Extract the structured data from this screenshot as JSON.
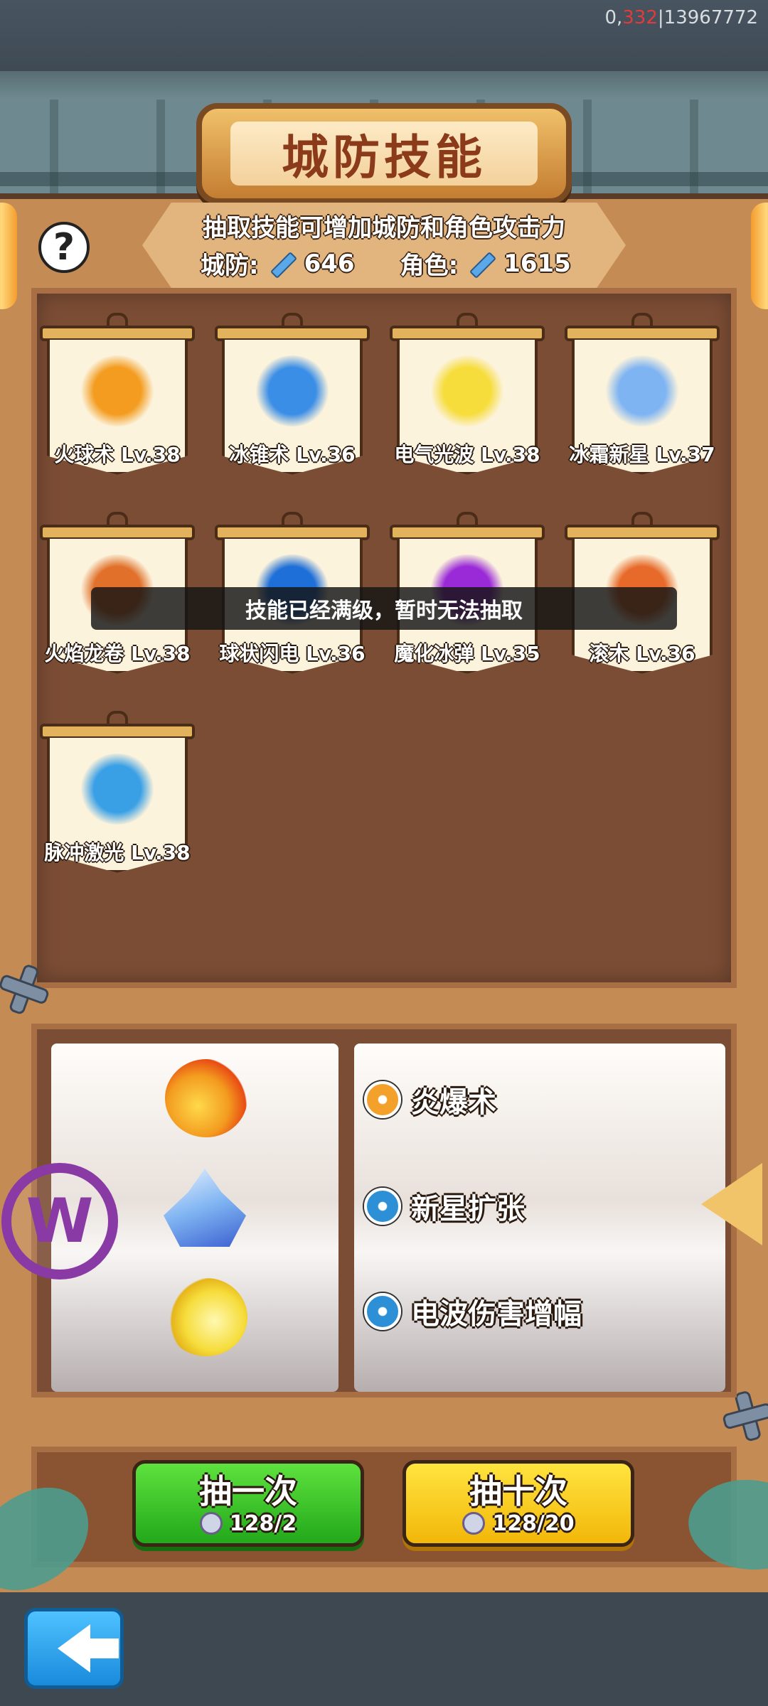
{
  "status_bar": {
    "prefix": "0,",
    "red": "332",
    "suffix": "|13967772"
  },
  "title": "城防技能",
  "info": {
    "description": "抽取技能可增加城防和角色攻击力",
    "defense_label": "城防:",
    "defense_value": "646",
    "role_label": "角色:",
    "role_value": "1615"
  },
  "help_label": "?",
  "skills": [
    {
      "label": "火球术 Lv.38",
      "icon": "fireball-icon",
      "color": "#f39c1f"
    },
    {
      "label": "冰锥术 Lv.36",
      "icon": "ice-cone-icon",
      "color": "#3b8ee6"
    },
    {
      "label": "电气光波 Lv.38",
      "icon": "electric-wave-icon",
      "color": "#f6dd3c"
    },
    {
      "label": "冰霜新星 Lv.37",
      "icon": "frost-nova-icon",
      "color": "#7fb4f2"
    },
    {
      "label": "火焰龙卷 Lv.38",
      "icon": "fire-tornado-icon",
      "color": "#e0702a"
    },
    {
      "label": "球状闪电 Lv.36",
      "icon": "ball-lightning-icon",
      "color": "#1f6fd8"
    },
    {
      "label": "魔化冰弹 Lv.35",
      "icon": "magic-ice-bomb-icon",
      "color": "#9a2ad8"
    },
    {
      "label": "滚木 Lv.36",
      "icon": "rolling-log-icon",
      "color": "#e86a2a"
    },
    {
      "label": "脉冲激光 Lv.38",
      "icon": "pulse-laser-icon",
      "color": "#3aa0e6"
    }
  ],
  "toast": "技能已经满级，暂时无法抽取",
  "draw_icons": [
    "fireball-icon",
    "frost-nova-icon",
    "electric-wave-icon"
  ],
  "buffs": [
    {
      "label": "炎爆术",
      "icon": "fire-buff-icon",
      "color": "#f3a12a"
    },
    {
      "label": "新星扩张",
      "icon": "star-buff-icon",
      "color": "#2d8fd6"
    },
    {
      "label": "电波伤害增幅",
      "icon": "star-buff-icon",
      "color": "#2d8fd6"
    }
  ],
  "draw_once": {
    "label": "抽一次",
    "cost": "128/2"
  },
  "draw_ten": {
    "label": "抽十次",
    "cost": "128/20"
  },
  "colors": {
    "wood": "#c58b55",
    "panel": "#7c4d35",
    "green": "#22a81a",
    "yellow": "#f2b70a",
    "accent_red": "#e13b3b"
  }
}
